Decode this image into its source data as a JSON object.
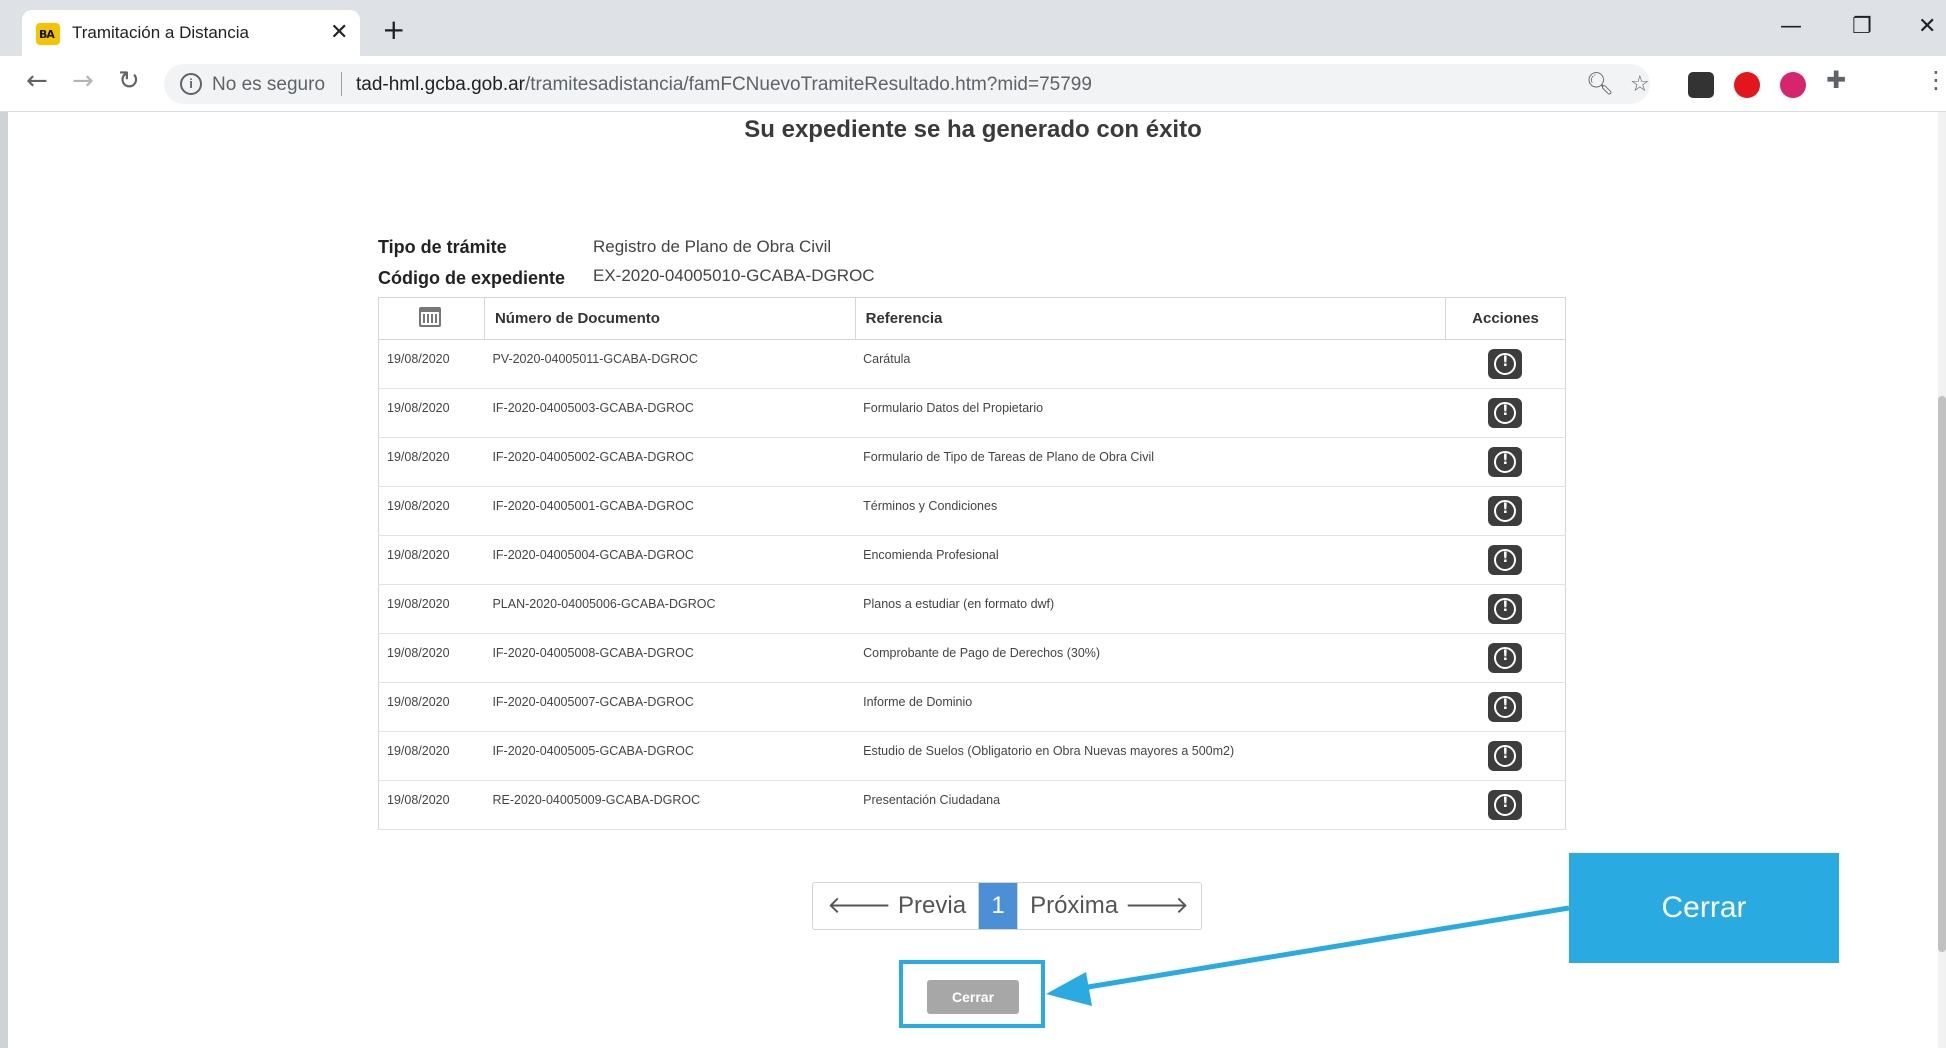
{
  "browser": {
    "tab_title": "Tramitación a Distancia",
    "tab_close": "✕",
    "new_tab": "+",
    "security_label": "No es seguro",
    "url_host": "tad-hml.gcba.gob.ar",
    "url_path": "/tramitesadistancia/famFCNuevoTramiteResultado.htm?mid=75799",
    "controls": {
      "minimize": "—",
      "restore": "❐",
      "close": "✕"
    }
  },
  "page": {
    "heading": "Su expediente se ha generado con éxito",
    "meta": [
      {
        "label": "Tipo de trámite",
        "value": "Registro de Plano de Obra Civil"
      },
      {
        "label": "Código de expediente",
        "value": "EX-2020-04005010-GCABA-DGROC"
      }
    ],
    "table": {
      "headers": {
        "number": "Número de Documento",
        "reference": "Referencia",
        "actions": "Acciones"
      },
      "rows": [
        {
          "date": "19/08/2020",
          "number": "PV-2020-04005011-GCABA-DGROC",
          "reference": "Carátula"
        },
        {
          "date": "19/08/2020",
          "number": "IF-2020-04005003-GCABA-DGROC",
          "reference": "Formulario Datos del Propietario"
        },
        {
          "date": "19/08/2020",
          "number": "IF-2020-04005002-GCABA-DGROC",
          "reference": "Formulario de Tipo de Tareas de Plano de Obra Civil"
        },
        {
          "date": "19/08/2020",
          "number": "IF-2020-04005001-GCABA-DGROC",
          "reference": "Términos y Condiciones"
        },
        {
          "date": "19/08/2020",
          "number": "IF-2020-04005004-GCABA-DGROC",
          "reference": "Encomienda Profesional"
        },
        {
          "date": "19/08/2020",
          "number": "PLAN-2020-04005006-GCABA-DGROC",
          "reference": "Planos a estudiar (en formato dwf)"
        },
        {
          "date": "19/08/2020",
          "number": "IF-2020-04005008-GCABA-DGROC",
          "reference": "Comprobante de Pago de Derechos (30%)"
        },
        {
          "date": "19/08/2020",
          "number": "IF-2020-04005007-GCABA-DGROC",
          "reference": "Informe de Dominio"
        },
        {
          "date": "19/08/2020",
          "number": "IF-2020-04005005-GCABA-DGROC",
          "reference": "Estudio de Suelos (Obligatorio en Obra Nuevas mayores a 500m2)"
        },
        {
          "date": "19/08/2020",
          "number": "RE-2020-04005009-GCABA-DGROC",
          "reference": "Presentación Ciudadana"
        }
      ]
    },
    "pagination": {
      "prev": "🡐 Previa",
      "current": "1",
      "next": "Próxima 🡒"
    },
    "close_button": "Cerrar"
  },
  "annotation": {
    "callout_text": "Cerrar",
    "color": "#29abe2"
  }
}
